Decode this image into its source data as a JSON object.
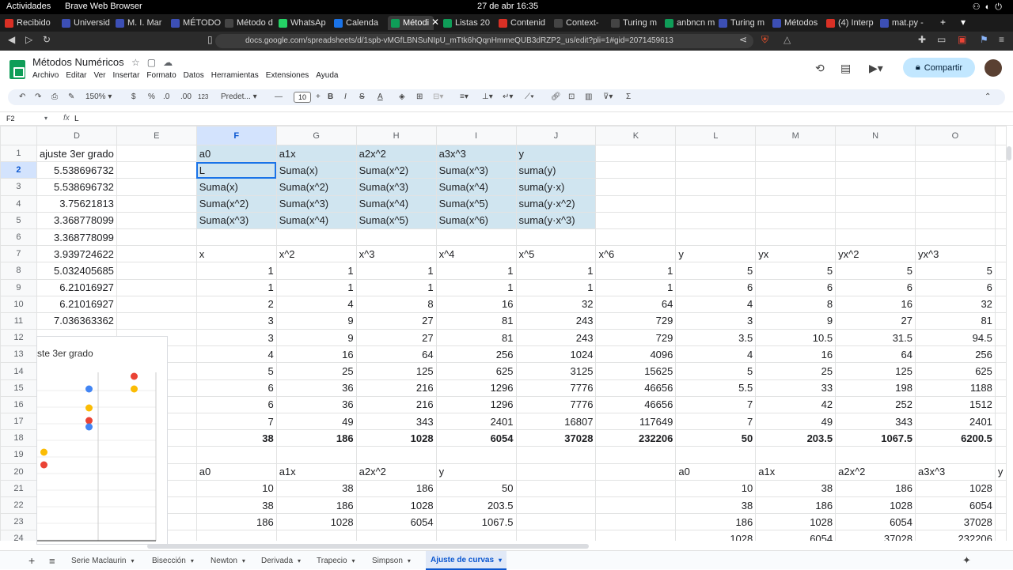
{
  "system": {
    "activities": "Actividades",
    "app": "Brave Web Browser",
    "clock": "27 de abr  16:35"
  },
  "browser": {
    "tabs": [
      {
        "label": "Recibido",
        "color": "#d93025"
      },
      {
        "label": "Universid",
        "color": "#3c4fb5"
      },
      {
        "label": "M. I. Mar",
        "color": "#3c4fb5"
      },
      {
        "label": "MÉTODO",
        "color": "#3c4fb5"
      },
      {
        "label": "Método d",
        "color": "#444444"
      },
      {
        "label": "WhatsAp",
        "color": "#25d366"
      },
      {
        "label": "Calenda",
        "color": "#1a73e8"
      },
      {
        "label": "Métodi",
        "color": "#0f9d58"
      },
      {
        "label": "Listas 20",
        "color": "#0f9d58"
      },
      {
        "label": "Contenid",
        "color": "#d93025"
      },
      {
        "label": "Context-",
        "color": "#444444"
      },
      {
        "label": "Turing m",
        "color": "#444444"
      },
      {
        "label": "anbncn m",
        "color": "#0f9d58"
      },
      {
        "label": "Turing m",
        "color": "#3c4fb5"
      },
      {
        "label": "Métodos",
        "color": "#3c4fb5"
      },
      {
        "label": "(4) Interp",
        "color": "#d93025"
      },
      {
        "label": "mat.py -",
        "color": "#3c4fb5"
      }
    ],
    "url": "docs.google.com/spreadsheets/d/1spb-vMGfLBNSuNIpU_mTtk6hQqnHmmeQUB3dRZP2_us/edit?pli=1#gid=2071459613"
  },
  "doc": {
    "title": "Métodos Numéricos",
    "menu": [
      "Archivo",
      "Editar",
      "Ver",
      "Insertar",
      "Formato",
      "Datos",
      "Herramientas",
      "Extensiones",
      "Ayuda"
    ],
    "share": "Compartir"
  },
  "toolbar": {
    "zoom": "150%",
    "currency": "$",
    "percent": "%",
    "dec_less": ".0",
    "dec_more": ".00",
    "numfmt": "123",
    "font": "Predet...",
    "fontsize": "10",
    "bold": "B",
    "italic": "I"
  },
  "formula": {
    "cell": "F2",
    "fx": "fx",
    "value": "L"
  },
  "columns": [
    "D",
    "E",
    "F",
    "G",
    "H",
    "I",
    "J",
    "K",
    "L",
    "M",
    "N",
    "O"
  ],
  "rows": [
    {
      "n": "1",
      "cells": [
        "ajuste 3er grado",
        "",
        "a0",
        "a1x",
        "a2x^2",
        "a3x^3",
        "y",
        "",
        "",
        "",
        "",
        ""
      ]
    },
    {
      "n": "2",
      "cells": [
        "5.538696732",
        "",
        "L",
        "Suma(x)",
        "Suma(x^2)",
        "Suma(x^3)",
        "suma(y)",
        "",
        "",
        "",
        "",
        ""
      ]
    },
    {
      "n": "3",
      "cells": [
        "5.538696732",
        "",
        "Suma(x)",
        "Suma(x^2)",
        "Suma(x^3)",
        "Suma(x^4)",
        "suma(y·x)",
        "",
        "",
        "",
        "",
        ""
      ]
    },
    {
      "n": "4",
      "cells": [
        "3.75621813",
        "",
        "Suma(x^2)",
        "Suma(x^3)",
        "Suma(x^4)",
        "Suma(x^5)",
        "suma(y·x^2)",
        "",
        "",
        "",
        "",
        ""
      ]
    },
    {
      "n": "5",
      "cells": [
        "3.368778099",
        "",
        "Suma(x^3)",
        "Suma(x^4)",
        "Suma(x^5)",
        "Suma(x^6)",
        "suma(y·x^3)",
        "",
        "",
        "",
        "",
        ""
      ]
    },
    {
      "n": "6",
      "cells": [
        "3.368778099",
        "",
        "",
        "",
        "",
        "",
        "",
        "",
        "",
        "",
        "",
        ""
      ]
    },
    {
      "n": "7",
      "cells": [
        "3.939724622",
        "",
        "x",
        "x^2",
        "x^3",
        "x^4",
        "x^5",
        "x^6",
        "y",
        "yx",
        "yx^2",
        "yx^3"
      ]
    },
    {
      "n": "8",
      "cells": [
        "5.032405685",
        "",
        "1",
        "1",
        "1",
        "1",
        "1",
        "1",
        "5",
        "5",
        "5",
        "5"
      ]
    },
    {
      "n": "9",
      "cells": [
        "6.21016927",
        "",
        "1",
        "1",
        "1",
        "1",
        "1",
        "1",
        "6",
        "6",
        "6",
        "6"
      ]
    },
    {
      "n": "10",
      "cells": [
        "6.21016927",
        "",
        "2",
        "4",
        "8",
        "16",
        "32",
        "64",
        "4",
        "8",
        "16",
        "32"
      ]
    },
    {
      "n": "11",
      "cells": [
        "7.036363362",
        "",
        "3",
        "9",
        "27",
        "81",
        "243",
        "729",
        "3",
        "9",
        "27",
        "81"
      ]
    },
    {
      "n": "12",
      "cells": [
        "",
        "",
        "3",
        "9",
        "27",
        "81",
        "243",
        "729",
        "3.5",
        "10.5",
        "31.5",
        "94.5"
      ]
    },
    {
      "n": "13",
      "cells": [
        "",
        "",
        "4",
        "16",
        "64",
        "256",
        "1024",
        "4096",
        "4",
        "16",
        "64",
        "256"
      ]
    },
    {
      "n": "14",
      "cells": [
        "",
        "",
        "5",
        "25",
        "125",
        "625",
        "3125",
        "15625",
        "5",
        "25",
        "125",
        "625"
      ]
    },
    {
      "n": "15",
      "cells": [
        "",
        "",
        "6",
        "36",
        "216",
        "1296",
        "7776",
        "46656",
        "5.5",
        "33",
        "198",
        "1188"
      ]
    },
    {
      "n": "16",
      "cells": [
        "",
        "",
        "6",
        "36",
        "216",
        "1296",
        "7776",
        "46656",
        "7",
        "42",
        "252",
        "1512"
      ]
    },
    {
      "n": "17",
      "cells": [
        "",
        "",
        "7",
        "49",
        "343",
        "2401",
        "16807",
        "117649",
        "7",
        "49",
        "343",
        "2401"
      ]
    },
    {
      "n": "18",
      "cells": [
        "",
        "",
        "38",
        "186",
        "1028",
        "6054",
        "37028",
        "232206",
        "50",
        "203.5",
        "1067.5",
        "6200.5"
      ]
    },
    {
      "n": "19",
      "cells": [
        "",
        "",
        "",
        "",
        "",
        "",
        "",
        "",
        "",
        "",
        "",
        ""
      ]
    },
    {
      "n": "20",
      "cells": [
        "",
        "",
        "a0",
        "a1x",
        "a2x^2",
        "y",
        "",
        "",
        "a0",
        "a1x",
        "a2x^2",
        "a3x^3"
      ]
    },
    {
      "n": "21",
      "cells": [
        "",
        "",
        "10",
        "38",
        "186",
        "50",
        "",
        "",
        "10",
        "38",
        "186",
        "1028"
      ]
    },
    {
      "n": "22",
      "cells": [
        "",
        "",
        "38",
        "186",
        "1028",
        "203.5",
        "",
        "",
        "38",
        "186",
        "1028",
        "6054"
      ]
    },
    {
      "n": "23",
      "cells": [
        "",
        "",
        "186",
        "1028",
        "6054",
        "1067.5",
        "",
        "",
        "186",
        "1028",
        "6054",
        "37028"
      ]
    },
    {
      "n": "24",
      "cells": [
        "",
        "",
        "",
        "",
        "",
        "",
        "",
        "",
        "1028",
        "6054",
        "37028",
        "232206"
      ]
    }
  ],
  "col_overflow": "y",
  "chart_overlay": {
    "title": "ste 3er grado"
  },
  "chart_data": {
    "type": "scatter",
    "title": "ste 3er grado",
    "series": [
      {
        "color": "#ea4335",
        "points": [
          [
            1,
            1.2
          ],
          [
            3,
            1.9
          ],
          [
            5,
            2.6
          ]
        ]
      },
      {
        "color": "#fbbc04",
        "points": [
          [
            1,
            1.4
          ],
          [
            3,
            2.1
          ],
          [
            5,
            2.4
          ]
        ]
      },
      {
        "color": "#4285f4",
        "points": [
          [
            3,
            1.8
          ],
          [
            3,
            2.4
          ]
        ]
      }
    ],
    "grid": true
  },
  "sheets": [
    "Serie Maclaurin",
    "Bisección",
    "Newton",
    "Derivada",
    "Trapecio",
    "Simpson",
    "Ajuste de curvas"
  ],
  "active_sheet": "Ajuste de curvas"
}
